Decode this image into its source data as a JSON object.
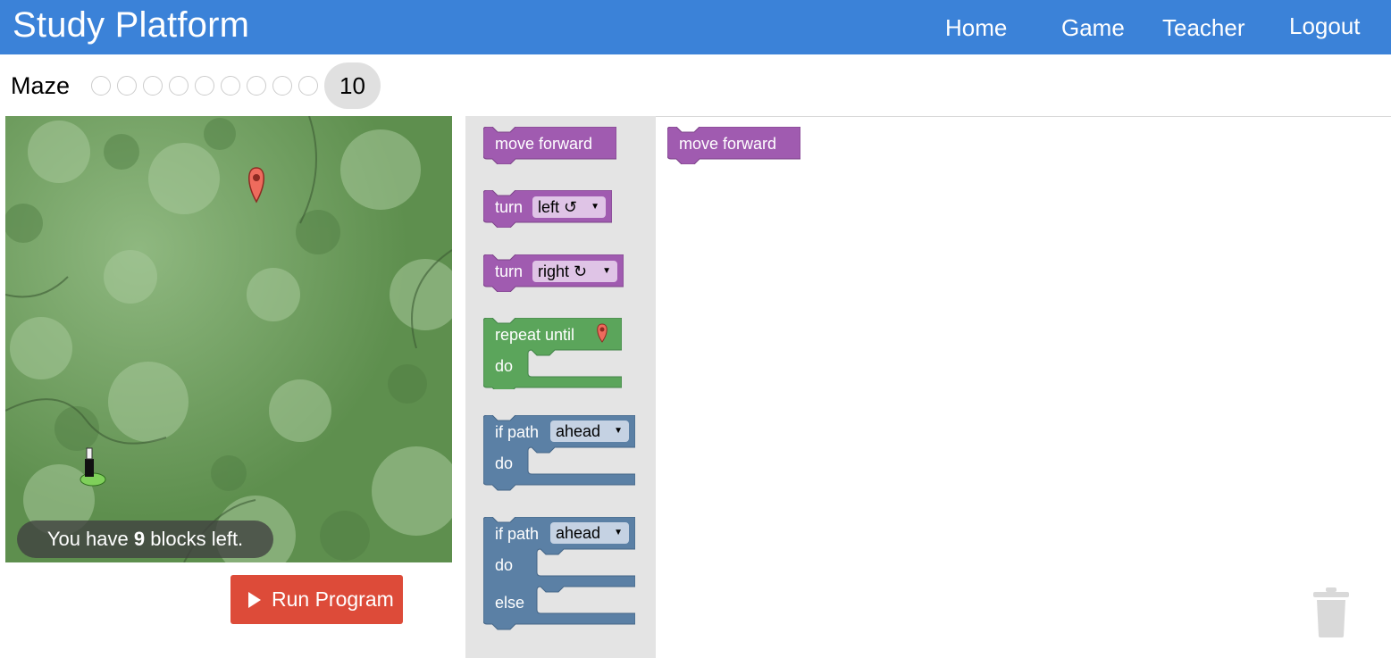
{
  "navbar": {
    "brand": "Study Platform",
    "links": [
      "Home",
      "Game",
      "Teacher",
      "Logout"
    ],
    "bg_color": "#3b82d8"
  },
  "level_bar": {
    "title": "Maze",
    "dot_count": 9,
    "current_level": "10"
  },
  "maze": {
    "blocks_left_prefix": "You have ",
    "blocks_left_count": "9",
    "blocks_left_suffix": " blocks left."
  },
  "run_button": {
    "label": "Run Program",
    "color": "#dd4b39"
  },
  "toolbox": {
    "move_forward": "move forward",
    "turn_left": {
      "label": "turn",
      "option": "left ↺"
    },
    "turn_right": {
      "label": "turn",
      "option": "right ↻"
    },
    "repeat_until": {
      "label": "repeat until",
      "do": "do"
    },
    "if_path": {
      "label": "if path",
      "option": "ahead",
      "do": "do"
    },
    "if_else": {
      "label": "if path",
      "option": "ahead",
      "do": "do",
      "else": "else"
    }
  },
  "workspace": {
    "blocks": [
      "move forward"
    ]
  },
  "colors": {
    "motion_block": "#a05bb0",
    "loop_block": "#5ba55b",
    "logic_block": "#5b80a5",
    "toolbox_bg": "#e4e4e4"
  }
}
